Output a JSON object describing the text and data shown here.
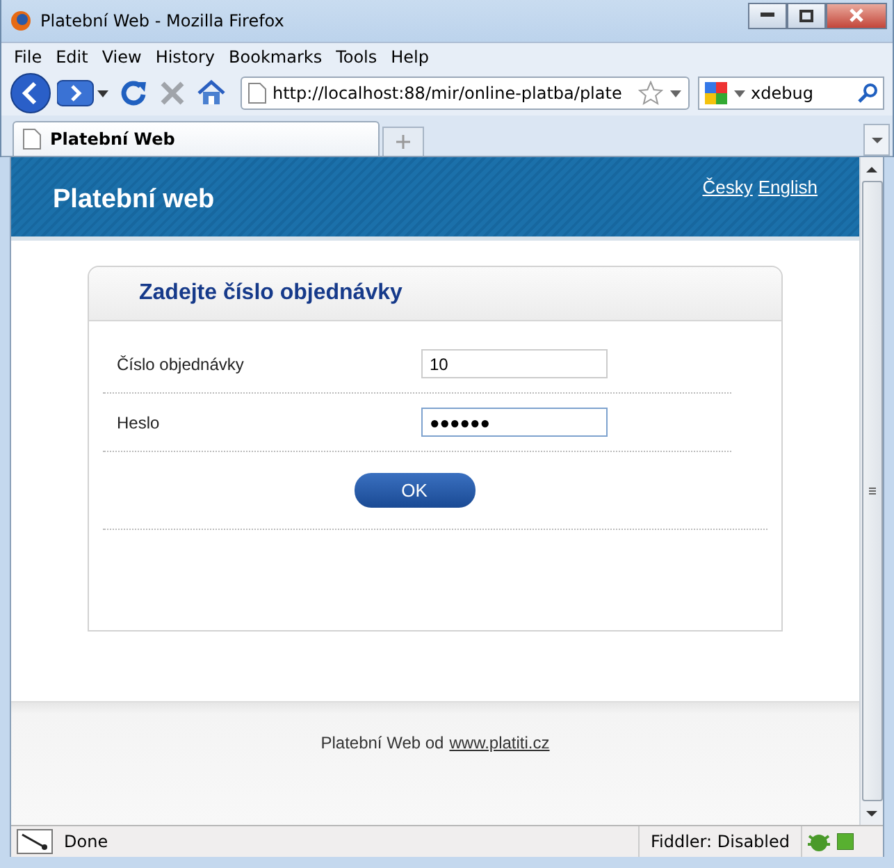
{
  "window": {
    "title": "Platební Web - Mozilla Firefox"
  },
  "menu": [
    "File",
    "Edit",
    "View",
    "History",
    "Bookmarks",
    "Tools",
    "Help"
  ],
  "address": {
    "value": "http://localhost:88/mir/online-platba/plate"
  },
  "search": {
    "value": "xdebug"
  },
  "tabs": [
    {
      "label": "Platební Web",
      "selected": true
    }
  ],
  "page": {
    "site_title": "Platební web",
    "languages": [
      "Česky",
      "English"
    ],
    "form": {
      "title": "Zadejte číslo objednávky",
      "fields": [
        {
          "label": "Číslo objednávky",
          "value": "10",
          "focused": false
        },
        {
          "label": "Heslo",
          "value": "●●●●●●",
          "focused": true
        }
      ],
      "submit": "OK"
    },
    "footer": {
      "text": "Platební Web od",
      "link": "www.platiti.cz"
    }
  },
  "status_bar": {
    "text": "Done",
    "fiddler": "Fiddler: Disabled"
  }
}
